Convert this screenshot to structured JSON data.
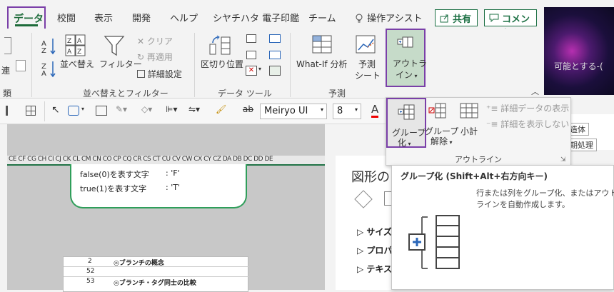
{
  "tabs": [
    "データ",
    "校閲",
    "表示",
    "開発",
    "ヘルプ",
    "シヤチハタ 電子印鑑",
    "チーム"
  ],
  "tell_me": "操作アシスト",
  "header_buttons": {
    "share": "共有",
    "comment": "コメント"
  },
  "ribbon": {
    "left_label_1": "類",
    "left_label_2": "連",
    "sort": "並べ替え",
    "filter": "フィルター",
    "clear": "クリア",
    "reapply": "再適用",
    "advanced": "詳細設定",
    "group_sort_filter": "並べ替えとフィルター",
    "text_to_columns": "区切り位置",
    "group_data_tools": "データ ツール",
    "whatif": "What-If 分析",
    "forecast_sheet_line1": "予測",
    "forecast_sheet_line2": "シート",
    "group_forecast": "予測",
    "outline_line1": "アウトラ",
    "outline_line2": "イン"
  },
  "format_bar": {
    "font": "Meiryo UI",
    "size": "8"
  },
  "outline_menu": {
    "group_line1": "グループ",
    "group_line2": "化",
    "ungroup_line1": "グループ",
    "ungroup_line2": "解除",
    "subtotal": "小計",
    "show_detail": "詳細データの表示",
    "hide_detail": "詳細を表示しない",
    "label": "アウトライン"
  },
  "right_strip": {
    "text1": "構造体",
    "text2": "同期処理",
    "text3": "可能とする-("
  },
  "column_headers": "CE CF CG CH CI CJ CK CL CM CN CO CP CQ CR CS CT CU CV CW CX CY CZ DA DB DC DD DE",
  "callout": {
    "row1_label": "false(0)を表す文字",
    "row1_value": ": 'F'",
    "row2_label": "true(1)を表す文字",
    "row2_value": ": 'T'"
  },
  "grid_rows": [
    {
      "num": "2",
      "text": "◎ブランチの概念"
    },
    {
      "num": "52",
      "text": ""
    },
    {
      "num": "53",
      "text": "◎ブランチ・タグ同士の比較"
    }
  ],
  "pane": {
    "title": "図形の",
    "items": [
      "サイズ",
      "プロパテ",
      "テキスト"
    ]
  },
  "tooltip": {
    "title": "グループ化 (Shift+Alt+右方向キー)",
    "desc_line1": "行または列をグループ化、またはアウト",
    "desc_line2": "ラインを自動作成します。"
  },
  "colors": {
    "accent": "#1d6b3a",
    "highlight": "#7a3fa8",
    "green_border": "#2f9e5a"
  }
}
